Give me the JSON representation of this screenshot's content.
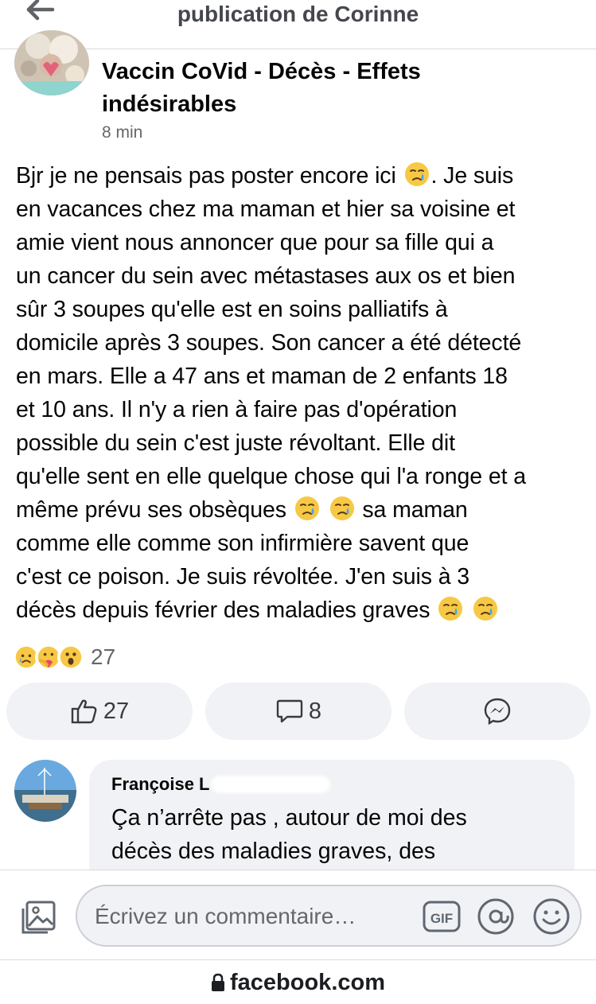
{
  "header": {
    "title": "publication de Corinne",
    "back_icon": "back-arrow-icon"
  },
  "post": {
    "group_name_line1": "Vaccin CoVid - Décès - Effets",
    "group_name_line2": "indésirables",
    "time": "8 min",
    "lines": [
      "Bjr je ne pensais pas poster encore ici",
      ". Je suis",
      "en vacances chez ma maman et hier sa voisine et",
      "amie vient nous annoncer que pour sa fille qui a",
      "un cancer du sein avec métastases aux os et bien",
      "sûr 3 soupes qu'elle est en soins palliatifs à",
      "domicile après 3 soupes. Son cancer a été détecté",
      "en mars. Elle a 47 ans et maman de 2 enfants 18",
      "et 10 ans. Il n'y a rien à faire pas d'opération",
      "possible du sein c'est juste révoltant. Elle dit",
      "qu'elle sent en elle quelque chose qui l'a ronge et a",
      "même prévu ses obsèques",
      "sa maman",
      "comme elle comme son infirmière savent que",
      "c'est ce poison. Je suis révoltée. J'en suis à 3",
      "décès depuis février des maladies graves"
    ],
    "inline_emoji": "crying-face-icon"
  },
  "reactions": {
    "icons": [
      "sad-face-icon",
      "care-hug-icon",
      "wow-face-icon"
    ],
    "count": "27"
  },
  "actions": {
    "like_count": "27",
    "comment_count": "8",
    "share_icon": "messenger-icon"
  },
  "comment": {
    "author": "Françoise L",
    "text_line1": "Ça n’arrête pas , autour de moi des",
    "text_line2": "décès des maladies graves, des"
  },
  "composer": {
    "placeholder": "Écrivez un commentaire…",
    "gif_label": "GIF"
  },
  "browser": {
    "url": "facebook.com"
  },
  "colors": {
    "pill_bg": "#f0f2f5",
    "secondary_text": "#65676b",
    "primary_text": "#050505",
    "emoji_yellow": "#f7c844",
    "tear_blue": "#4aa3e8"
  }
}
